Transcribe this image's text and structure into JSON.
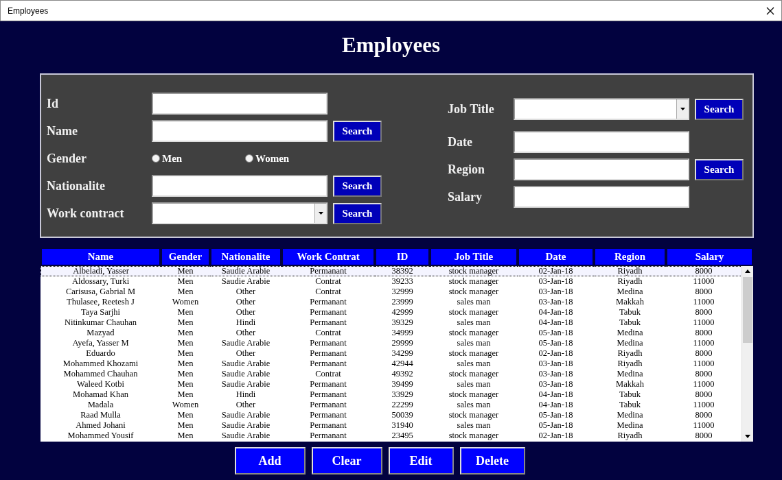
{
  "window": {
    "title": "Employees"
  },
  "heading": "Employees",
  "filters_left": [
    {
      "kind": "text",
      "label": "Id"
    },
    {
      "kind": "text",
      "label": "Name",
      "button": "Search"
    },
    {
      "kind": "radio",
      "label": "Gender",
      "options": [
        {
          "label": "Men",
          "checked": false
        },
        {
          "label": "Women",
          "checked": false
        }
      ]
    },
    {
      "kind": "text",
      "label": "Nationalite",
      "button": "Search"
    },
    {
      "kind": "select",
      "label": "Work contract",
      "button": "Search"
    }
  ],
  "filters_right": [
    {
      "kind": "select",
      "label": "Job Title",
      "button": "Search"
    },
    {
      "kind": "text",
      "label": "Date"
    },
    {
      "kind": "text",
      "label": "Region",
      "button": "Search"
    },
    {
      "kind": "text",
      "label": "Salary"
    }
  ],
  "table": {
    "columns": [
      "Name",
      "Gender",
      "Nationalite",
      "Work Contrat",
      "ID",
      "Job Title",
      "Date",
      "Region",
      "Salary"
    ],
    "rows": [
      {
        "selected": true,
        "cells": [
          "Albeladi, Yasser",
          "Men",
          "Saudie Arabie",
          "Permanant",
          "38392",
          "stock manager",
          "02-Jan-18",
          "Riyadh",
          "8000"
        ]
      },
      {
        "selected": false,
        "cells": [
          "Aldossary, Turki",
          "Men",
          "Saudie Arabie",
          "Contrat",
          "39233",
          "stock manager",
          "03-Jan-18",
          "Riyadh",
          "11000"
        ]
      },
      {
        "selected": false,
        "cells": [
          "Carisusa, Gabrial M",
          "Men",
          "Other",
          "Contrat",
          "32999",
          "stock manager",
          "03-Jan-18",
          "Medina",
          "8000"
        ]
      },
      {
        "selected": false,
        "cells": [
          "Thulasee, Reetesh J",
          "Women",
          "Other",
          "Permanant",
          "23999",
          "sales man",
          "03-Jan-18",
          "Makkah",
          "11000"
        ]
      },
      {
        "selected": false,
        "cells": [
          "Taya Sarjhi",
          "Men",
          "Other",
          "Permanant",
          "42999",
          "stock manager",
          "04-Jan-18",
          "Tabuk",
          "8000"
        ]
      },
      {
        "selected": false,
        "cells": [
          "Nitinkumar Chauhan",
          "Men",
          "Hindi",
          "Permanant",
          "39329",
          "sales man",
          "04-Jan-18",
          "Tabuk",
          "11000"
        ]
      },
      {
        "selected": false,
        "cells": [
          "Mazyad",
          "Men",
          "Other",
          "Contrat",
          "34999",
          "stock manager",
          "05-Jan-18",
          "Medina",
          "8000"
        ]
      },
      {
        "selected": false,
        "cells": [
          "Ayefa, Yasser M",
          "Men",
          "Saudie Arabie",
          "Permanant",
          "29999",
          "sales man",
          "05-Jan-18",
          "Medina",
          "11000"
        ]
      },
      {
        "selected": false,
        "cells": [
          "Eduardo",
          "Men",
          "Other",
          "Permanant",
          "34299",
          "stock manager",
          "02-Jan-18",
          "Riyadh",
          "8000"
        ]
      },
      {
        "selected": false,
        "cells": [
          "Mohammed Khozami",
          "Men",
          "Saudie Arabie",
          "Permanant",
          "42944",
          "sales man",
          "03-Jan-18",
          "Riyadh",
          "11000"
        ]
      },
      {
        "selected": false,
        "cells": [
          "Mohammed Chauhan",
          "Men",
          "Saudie Arabie",
          "Contrat",
          "49392",
          "stock manager",
          "03-Jan-18",
          "Medina",
          "8000"
        ]
      },
      {
        "selected": false,
        "cells": [
          "Waleed Kotbi",
          "Men",
          "Saudie Arabie",
          "Permanant",
          "39499",
          "sales man",
          "03-Jan-18",
          "Makkah",
          "11000"
        ]
      },
      {
        "selected": false,
        "cells": [
          "Mohamad Khan",
          "Men",
          "Hindi",
          "Permanant",
          "33929",
          "stock manager",
          "04-Jan-18",
          "Tabuk",
          "8000"
        ]
      },
      {
        "selected": false,
        "cells": [
          "Madala",
          "Women",
          "Other",
          "Permanant",
          "22299",
          "sales man",
          "04-Jan-18",
          "Tabuk",
          "11000"
        ]
      },
      {
        "selected": false,
        "cells": [
          "Raad Mulla",
          "Men",
          "Saudie Arabie",
          "Permanant",
          "50039",
          "stock manager",
          "05-Jan-18",
          "Medina",
          "8000"
        ]
      },
      {
        "selected": false,
        "cells": [
          "Ahmed Johani",
          "Men",
          "Saudie Arabie",
          "Permanant",
          "31940",
          "sales man",
          "05-Jan-18",
          "Medina",
          "11000"
        ]
      },
      {
        "selected": false,
        "cells": [
          "Mohammed Yousif",
          "Men",
          "Saudie Arabie",
          "Permanant",
          "23495",
          "stock manager",
          "02-Jan-18",
          "Riyadh",
          "8000"
        ]
      }
    ]
  },
  "buttons": [
    "Add",
    "Clear",
    "Edit",
    "Delete"
  ]
}
